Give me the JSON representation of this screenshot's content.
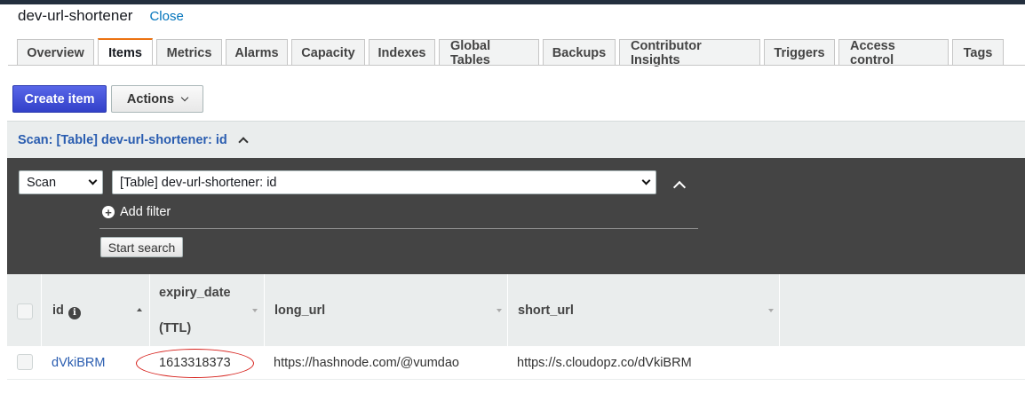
{
  "header": {
    "table_name": "dev-url-shortener",
    "close_label": "Close"
  },
  "tabs": [
    {
      "label": "Overview",
      "active": false
    },
    {
      "label": "Items",
      "active": true
    },
    {
      "label": "Metrics",
      "active": false
    },
    {
      "label": "Alarms",
      "active": false
    },
    {
      "label": "Capacity",
      "active": false
    },
    {
      "label": "Indexes",
      "active": false
    },
    {
      "label": "Global Tables",
      "active": false
    },
    {
      "label": "Backups",
      "active": false
    },
    {
      "label": "Contributor Insights",
      "active": false
    },
    {
      "label": "Triggers",
      "active": false
    },
    {
      "label": "Access control",
      "active": false
    },
    {
      "label": "Tags",
      "active": false
    }
  ],
  "toolbar": {
    "create_label": "Create item",
    "actions_label": "Actions"
  },
  "scan": {
    "header_text": "Scan: [Table] dev-url-shortener: id",
    "mode_value": "Scan",
    "target_value": "[Table] dev-url-shortener: id",
    "add_filter_label": "Add filter",
    "start_search_label": "Start search"
  },
  "grid": {
    "columns": {
      "id": "id",
      "expiry_line1": "expiry_date",
      "expiry_line2": "(TTL)",
      "long_url": "long_url",
      "short_url": "short_url"
    },
    "rows": [
      {
        "id": "dVkiBRM",
        "expiry_date": "1613318373",
        "long_url": "https://hashnode.com/@vumdao",
        "short_url": "https://s.cloudopz.co/dVkiBRM"
      }
    ]
  },
  "colors": {
    "primary_button": "#3f51d8",
    "link": "#2a5db0",
    "active_tab_accent": "#ec7211",
    "annotation": "#d6201b"
  }
}
